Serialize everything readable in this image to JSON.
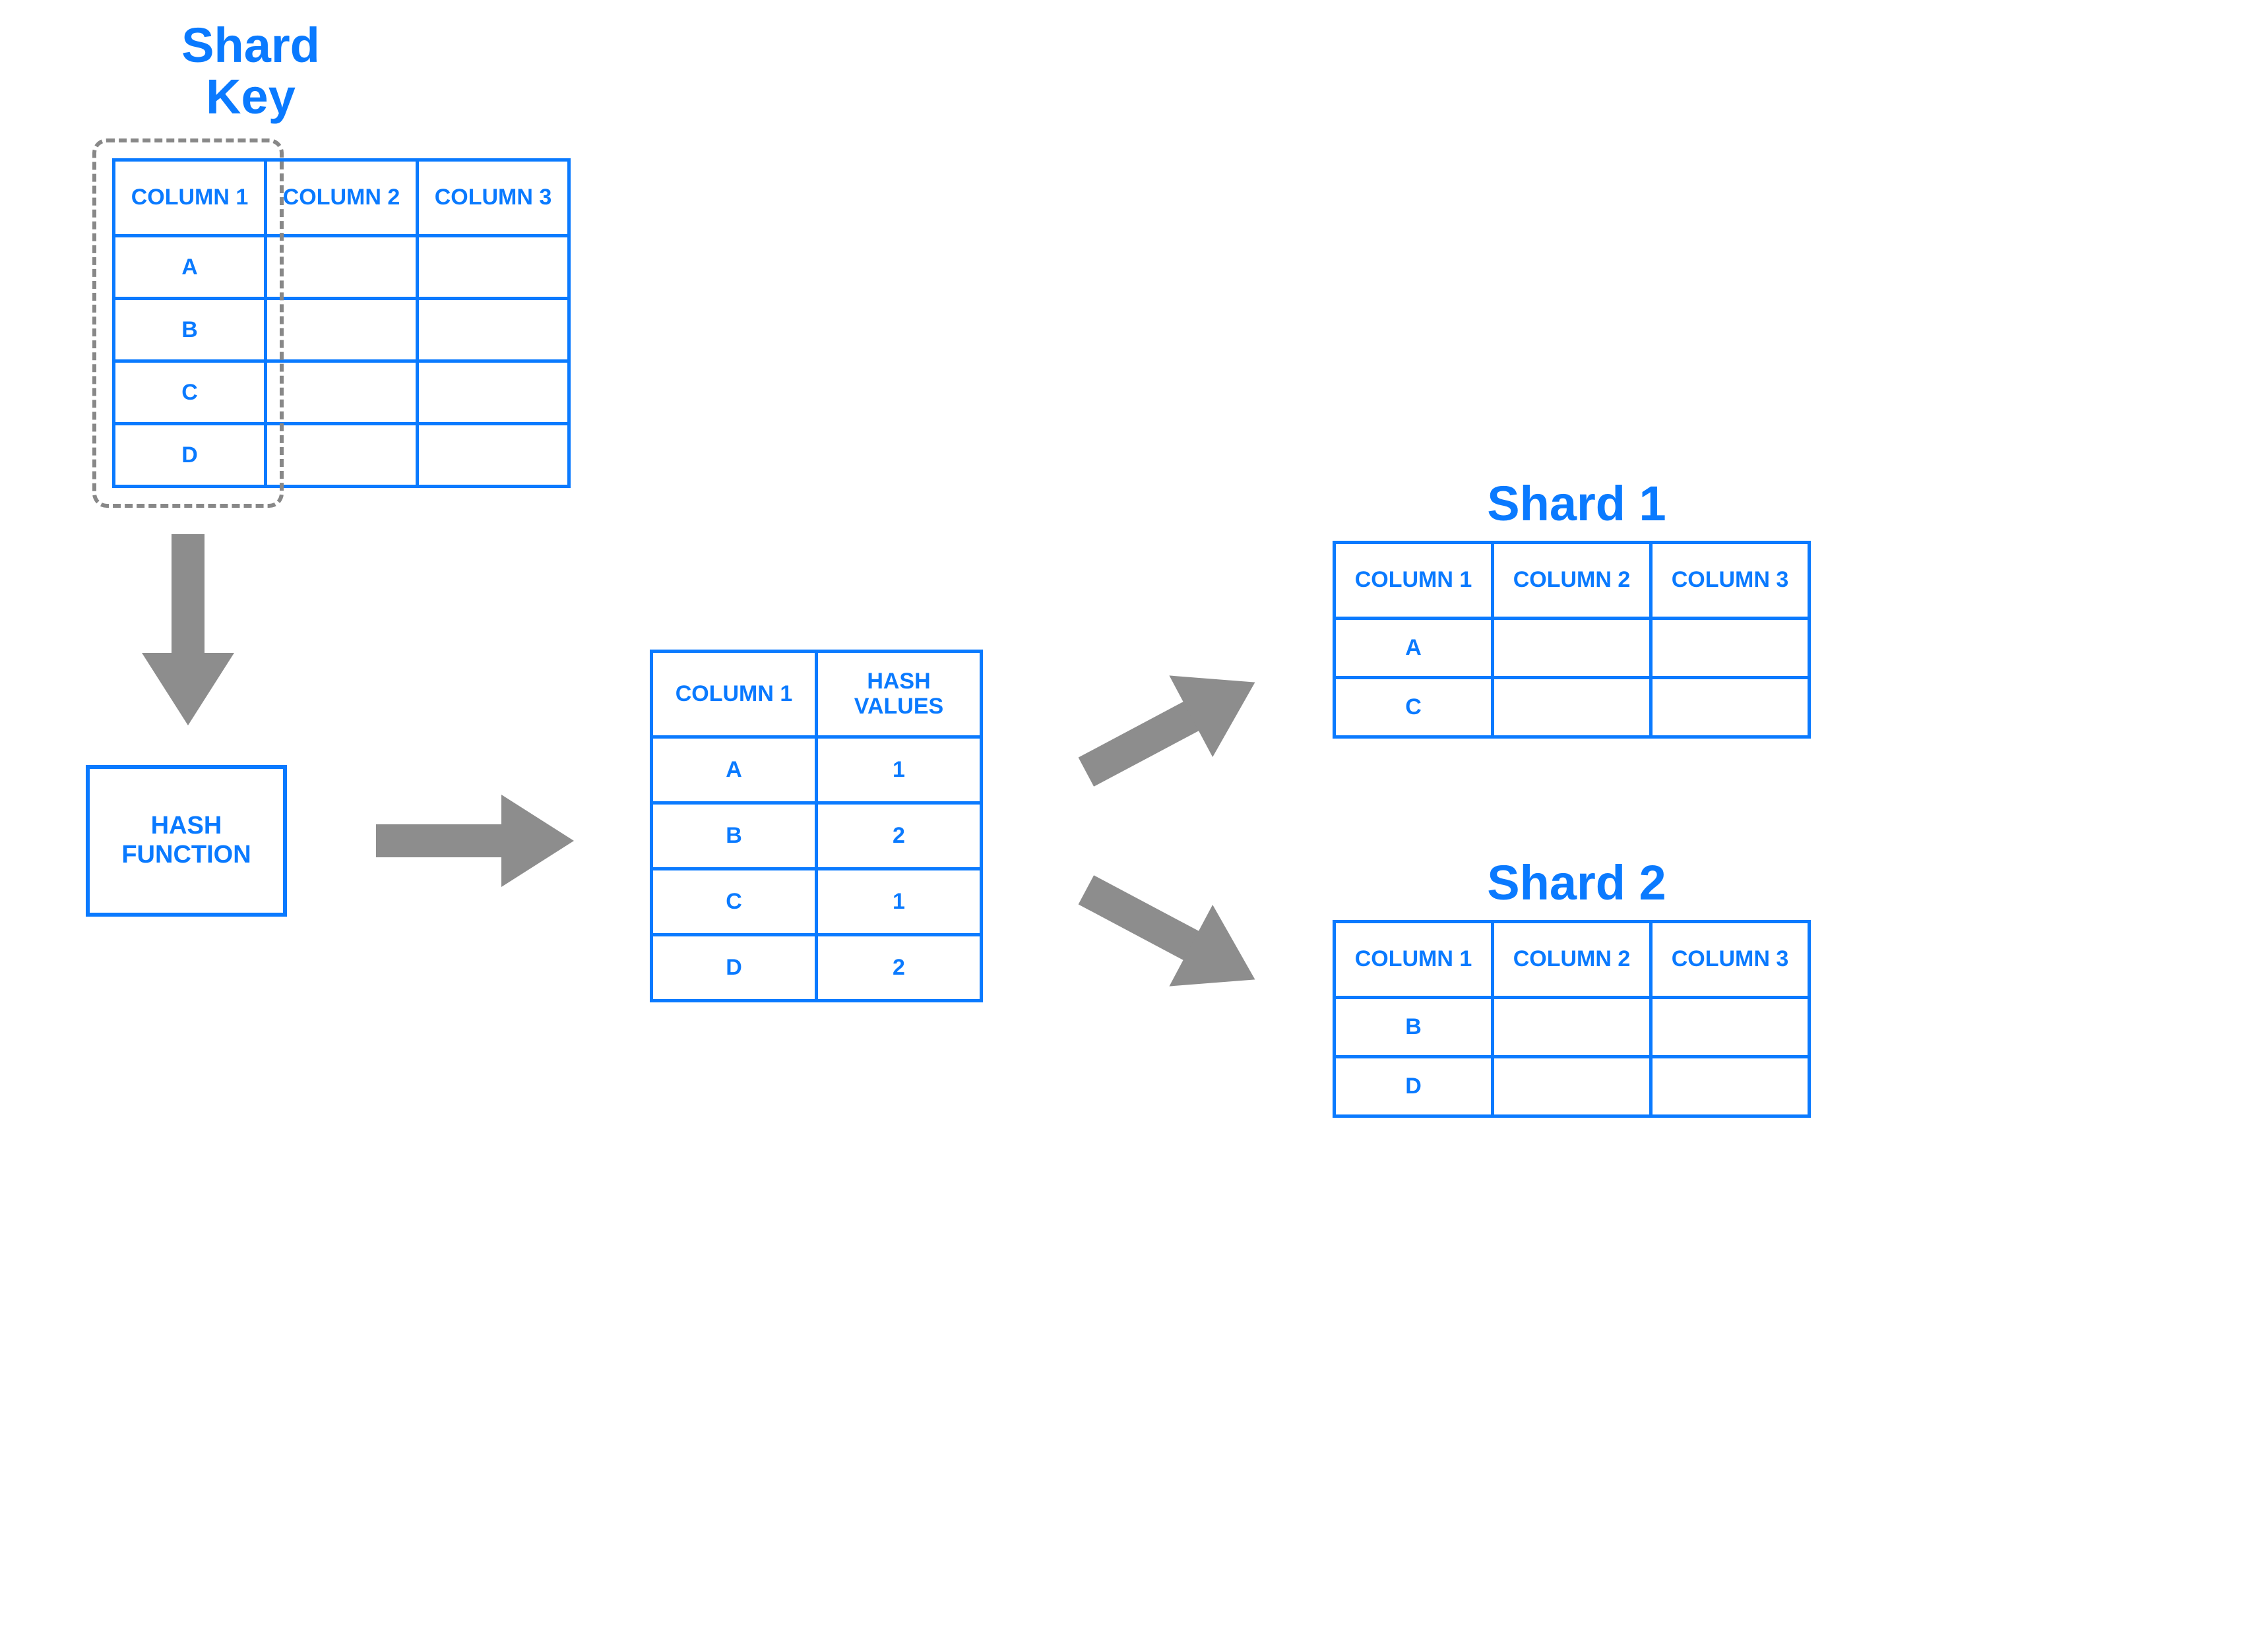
{
  "labels": {
    "shard_key_line1": "Shard",
    "shard_key_line2": "Key",
    "hash_function_line1": "HASH",
    "hash_function_line2": "FUNCTION",
    "shard1": "Shard 1",
    "shard2": "Shard 2"
  },
  "source_table": {
    "headers": [
      "COLUMN 1",
      "COLUMN 2",
      "COLUMN 3"
    ],
    "rows": [
      [
        "A",
        "",
        ""
      ],
      [
        "B",
        "",
        ""
      ],
      [
        "C",
        "",
        ""
      ],
      [
        "D",
        "",
        ""
      ]
    ]
  },
  "hash_table": {
    "headers": [
      "COLUMN 1",
      "HASH VALUES"
    ],
    "rows": [
      [
        "A",
        "1"
      ],
      [
        "B",
        "2"
      ],
      [
        "C",
        "1"
      ],
      [
        "D",
        "2"
      ]
    ]
  },
  "shard1_table": {
    "headers": [
      "COLUMN 1",
      "COLUMN 2",
      "COLUMN 3"
    ],
    "rows": [
      [
        "A",
        "",
        ""
      ],
      [
        "C",
        "",
        ""
      ]
    ]
  },
  "shard2_table": {
    "headers": [
      "COLUMN 1",
      "COLUMN 2",
      "COLUMN 3"
    ],
    "rows": [
      [
        "B",
        "",
        ""
      ],
      [
        "D",
        "",
        ""
      ]
    ]
  },
  "chart_data": {
    "type": "table",
    "description": "Hash-based sharding diagram: a shard key column feeds a hash function producing hash values that route rows to Shard 1 or Shard 2.",
    "source_columns": [
      "COLUMN 1",
      "COLUMN 2",
      "COLUMN 3"
    ],
    "source_rows": [
      "A",
      "B",
      "C",
      "D"
    ],
    "shard_key_column": "COLUMN 1",
    "hash_mapping": [
      {
        "key": "A",
        "hash": 1,
        "shard": "Shard 1"
      },
      {
        "key": "B",
        "hash": 2,
        "shard": "Shard 2"
      },
      {
        "key": "C",
        "hash": 1,
        "shard": "Shard 1"
      },
      {
        "key": "D",
        "hash": 2,
        "shard": "Shard 2"
      }
    ],
    "shards": {
      "Shard 1": [
        "A",
        "C"
      ],
      "Shard 2": [
        "B",
        "D"
      ]
    }
  }
}
